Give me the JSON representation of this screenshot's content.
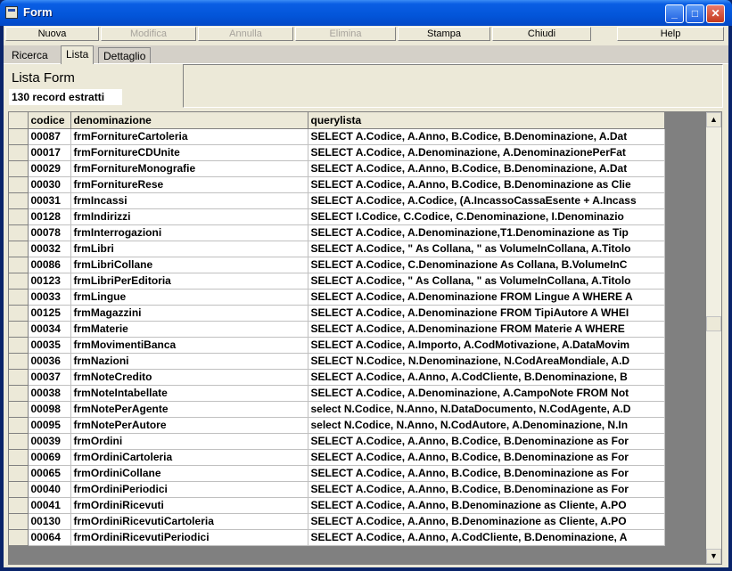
{
  "window": {
    "title": "Form"
  },
  "menu": [
    {
      "label": "Nuova",
      "enabled": true
    },
    {
      "label": "Modifica",
      "enabled": false
    },
    {
      "label": "Annulla",
      "enabled": false
    },
    {
      "label": "Elimina",
      "enabled": false
    },
    {
      "label": "Stampa",
      "enabled": true
    },
    {
      "label": "Chiudi",
      "enabled": true
    },
    {
      "label": "Help",
      "enabled": true
    }
  ],
  "tabs": [
    "Ricerca",
    "Lista",
    "Dettaglio"
  ],
  "heading": "Lista Form",
  "record_count": "130 record estratti",
  "table": {
    "columns": [
      "codice",
      "denominazione",
      "querylista"
    ],
    "rows": [
      [
        "00087",
        "frmFornitureCartoleria",
        "SELECT A.Codice, A.Anno, B.Codice, B.Denominazione, A.Dat"
      ],
      [
        "00017",
        "frmFornitureCDUnite",
        "SELECT A.Codice, A.Denominazione, A.DenominazionePerFat"
      ],
      [
        "00029",
        "frmFornitureMonografie",
        "SELECT A.Codice, A.Anno, B.Codice, B.Denominazione, A.Dat"
      ],
      [
        "00030",
        "frmFornitureRese",
        "SELECT A.Codice, A.Anno, B.Codice, B.Denominazione as Clie"
      ],
      [
        "00031",
        "frmIncassi",
        "SELECT A.Codice, A.Codice, (A.IncassoCassaEsente + A.Incass"
      ],
      [
        "00128",
        "frmIndirizzi",
        "SELECT I.Codice, C.Codice, C.Denominazione, I.Denominazio"
      ],
      [
        "00078",
        "frmInterrogazioni",
        "SELECT A.Codice, A.Denominazione,T1.Denominazione as Tip"
      ],
      [
        "00032",
        "frmLibri",
        "SELECT A.Codice, \" As Collana, \" as VolumeInCollana, A.Titolo"
      ],
      [
        "00086",
        "frmLibriCollane",
        "SELECT A.Codice, C.Denominazione As Collana, B.VolumeInC"
      ],
      [
        "00123",
        "frmLibriPerEditoria",
        "SELECT A.Codice, \" As Collana, \" as VolumeInCollana, A.Titolo"
      ],
      [
        "00033",
        "frmLingue",
        "SELECT A.Codice, A.Denominazione FROM Lingue A WHERE A"
      ],
      [
        "00125",
        "frmMagazzini",
        "SELECT A.Codice, A.Denominazione FROM TipiAutore A WHEI"
      ],
      [
        "00034",
        "frmMaterie",
        "SELECT A.Codice, A.Denominazione FROM Materie A WHERE"
      ],
      [
        "00035",
        "frmMovimentiBanca",
        "SELECT A.Codice, A.Importo, A.CodMotivazione, A.DataMovim"
      ],
      [
        "00036",
        "frmNazioni",
        "SELECT N.Codice, N.Denominazione, N.CodAreaMondiale, A.D"
      ],
      [
        "00037",
        "frmNoteCredito",
        "SELECT A.Codice, A.Anno, A.CodCliente, B.Denominazione, B"
      ],
      [
        "00038",
        "frmNoteIntabellate",
        "SELECT A.Codice, A.Denominazione, A.CampoNote FROM Not"
      ],
      [
        "00098",
        "frmNotePerAgente",
        "select N.Codice, N.Anno, N.DataDocumento, N.CodAgente, A.D"
      ],
      [
        "00095",
        "frmNotePerAutore",
        "select N.Codice, N.Anno, N.CodAutore, A.Denominazione, N.In"
      ],
      [
        "00039",
        "frmOrdini",
        "SELECT A.Codice, A.Anno, B.Codice, B.Denominazione as For"
      ],
      [
        "00069",
        "frmOrdiniCartoleria",
        "SELECT A.Codice, A.Anno, B.Codice, B.Denominazione as For"
      ],
      [
        "00065",
        "frmOrdiniCollane",
        "SELECT A.Codice, A.Anno, B.Codice, B.Denominazione as For"
      ],
      [
        "00040",
        "frmOrdiniPeriodici",
        "SELECT A.Codice, A.Anno, B.Codice, B.Denominazione as For"
      ],
      [
        "00041",
        "frmOrdiniRicevuti",
        "SELECT A.Codice, A.Anno, B.Denominazione as Cliente, A.PO"
      ],
      [
        "00130",
        "frmOrdiniRicevutiCartoleria",
        "SELECT A.Codice, A.Anno, B.Denominazione as Cliente, A.PO"
      ],
      [
        "00064",
        "frmOrdiniRicevutiPeriodici",
        "SELECT A.Codice, A.Anno, A.CodCliente, B.Denominazione, A"
      ]
    ]
  },
  "icons": {
    "app": "form-icon",
    "minimize": "minimize-icon",
    "maximize": "maximize-icon",
    "close": "close-icon",
    "scroll_up": "arrow-up-icon",
    "scroll_down": "arrow-down-icon"
  }
}
